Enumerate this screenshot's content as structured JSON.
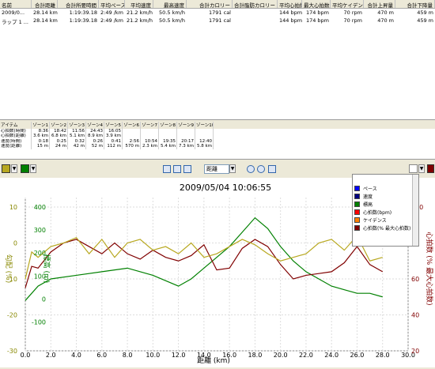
{
  "summary_table": {
    "headers": [
      "名前",
      "合計距離",
      "合計所要時間",
      "平均ペース",
      "平均速度",
      "最高速度",
      "合計カロリー",
      "合計脂肪カロリー",
      "平均心拍数",
      "最大心拍数",
      "平均ケイデンス",
      "合計上昇量",
      "合計下降量"
    ],
    "rows": [
      [
        "2009/0...",
        "28.14 km",
        "1:19:39.18",
        "2:49 /km",
        "21.2 km/h",
        "50.5 km/h",
        "1791 cal",
        "",
        "144 bpm",
        "174 bpm",
        "70 rpm",
        "470 m",
        "459 m"
      ],
      [
        "ラップ 1 ...",
        "28.14 km",
        "1:19:39.18",
        "2:49 /km",
        "21.2 km/h",
        "50.5 km/h",
        "1791 cal",
        "",
        "144 bpm",
        "174 bpm",
        "70 rpm",
        "470 m",
        "459 m"
      ]
    ]
  },
  "zone_table": {
    "headers": [
      "アイテム",
      "ゾーン1",
      "ゾーン2",
      "ゾーン3",
      "ゾーン4",
      "ゾーン5",
      "ゾーン6",
      "ゾーン7",
      "ゾーン8",
      "ゾーン9",
      "ゾーン10"
    ],
    "rows": [
      [
        "心拍数(時間)",
        "8:36",
        "18:42",
        "11:56",
        "24:43",
        "16:05",
        "",
        "",
        "",
        "",
        ""
      ],
      [
        "心拍数(距離)",
        "3.6 km",
        "6.8 km",
        "5.1 km",
        "8.9 km",
        "3.9 km",
        "",
        "",
        "",
        "",
        ""
      ],
      [
        "速度(時間)",
        "0:18",
        "0:25",
        "0:32",
        "0:26",
        "0:41",
        "2:56",
        "10:54",
        "19:35",
        "20:17",
        "12:40"
      ],
      [
        "速度(距離)",
        "15 m",
        "24 m",
        "42 m",
        "52 m",
        "112 m",
        "570 m",
        "2.3 km",
        "5.4 km",
        "7.3 km",
        "5.8 km"
      ]
    ]
  },
  "toolbar": {
    "x_axis_select": "距離"
  },
  "legend": {
    "items": [
      {
        "label": "ペース",
        "color": "#0000ff"
      },
      {
        "label": "速度",
        "color": "#000080"
      },
      {
        "label": "標高",
        "color": "#008000"
      },
      {
        "label": "心拍数(bpm)",
        "color": "#ff0000"
      },
      {
        "label": "ケイデンス",
        "color": "#ff8000"
      },
      {
        "label": "心拍数(% 最大心拍数)",
        "color": "#800000"
      }
    ]
  },
  "chart_data": {
    "type": "line",
    "title": "2009/05/04 10:06:55",
    "xlabel": "距離 (km)",
    "ylabel_left": "勾配 (%)",
    "ylabel_left_inner": "標高 (m)",
    "ylabel_right": "心拍数 (% 最大心拍数)",
    "xlim": [
      0,
      30
    ],
    "x_ticks": [
      "0.0",
      "2.0",
      "4.0",
      "6.0",
      "8.0",
      "10.0",
      "12.0",
      "14.0",
      "16.0",
      "18.0",
      "20.0",
      "22.0",
      "24.0",
      "26.0",
      "28.0",
      "30.0"
    ],
    "y_left_ticks": [
      "10",
      "0",
      "-10",
      "-20",
      "-30"
    ],
    "y_left_inner_ticks": [
      "400",
      "300",
      "200",
      "100",
      "0",
      "-100"
    ],
    "y_right_ticks": [
      "100",
      "80",
      "60",
      "40",
      "20"
    ],
    "series": [
      {
        "name": "標高",
        "color": "#008000",
        "x": [
          0,
          1,
          2,
          4,
          6,
          8,
          10,
          12,
          13,
          14,
          15,
          16,
          17,
          18,
          19,
          20,
          21,
          22,
          23,
          24,
          25,
          26,
          27,
          28
        ],
        "y": [
          -16,
          -12,
          -10,
          -9,
          -8,
          -7,
          -9,
          -12,
          -10,
          -7,
          -4,
          -1,
          3,
          7,
          4,
          -1,
          -5,
          -8,
          -10,
          -12,
          -13,
          -14,
          -14,
          -15
        ]
      },
      {
        "name": "心拍数(% 最大心拍数)",
        "color": "#800000",
        "x": [
          0,
          0.5,
          1,
          2,
          3,
          4,
          5,
          6,
          7,
          8,
          9,
          10,
          11,
          12,
          13,
          14,
          15,
          16,
          17,
          18,
          19,
          20,
          21,
          22,
          23,
          24,
          25,
          26,
          27,
          28
        ],
        "y": [
          55,
          67,
          66,
          75,
          80,
          82,
          78,
          74,
          80,
          74,
          71,
          76,
          72,
          70,
          73,
          79,
          65,
          66,
          77,
          82,
          78,
          68,
          60,
          62,
          63,
          64,
          69,
          78,
          68,
          64
        ]
      },
      {
        "name": "ケイデンス",
        "color": "#b8a820",
        "x": [
          0,
          0.5,
          1,
          2,
          3,
          4,
          5,
          6,
          7,
          8,
          9,
          10,
          11,
          12,
          13,
          14,
          15,
          16,
          17,
          18,
          19,
          20,
          21,
          22,
          23,
          24,
          25,
          26,
          27,
          28
        ],
        "y": [
          60,
          75,
          72,
          78,
          80,
          83,
          74,
          82,
          72,
          80,
          82,
          76,
          78,
          74,
          80,
          72,
          74,
          78,
          82,
          79,
          74,
          70,
          72,
          74,
          80,
          82,
          76,
          84,
          70,
          72
        ]
      }
    ]
  }
}
